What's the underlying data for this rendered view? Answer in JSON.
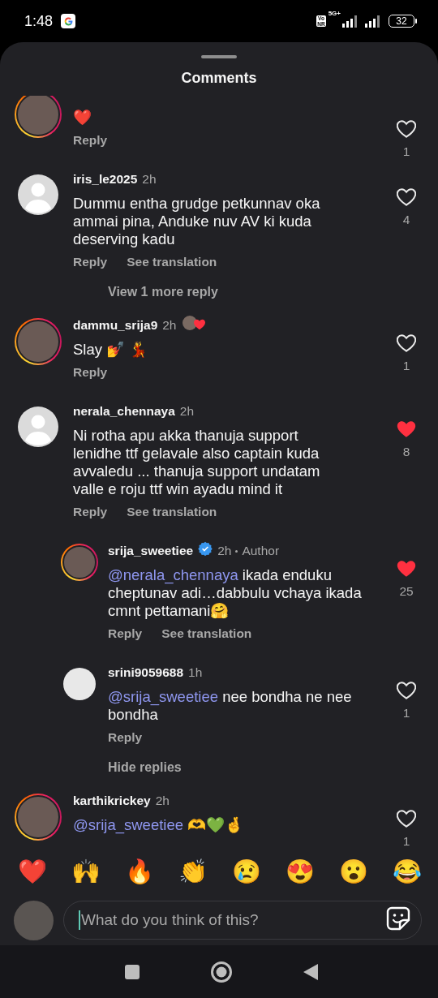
{
  "status_bar": {
    "time": "1:48",
    "network_badge": [
      "Vo",
      "NR"
    ],
    "network_type": "5G+",
    "battery": "32"
  },
  "sheet": {
    "title": "Comments"
  },
  "comments": [
    {
      "kind": "story",
      "text": "❤️",
      "likes": "1",
      "liked": false,
      "actions": [
        "Reply"
      ]
    },
    {
      "kind": "default",
      "username": "iris_le2025",
      "time": "2h",
      "text": "Dummu entha grudge petkunnav oka ammai pina, Anduke nuv AV ki kuda deserving kadu",
      "likes": "4",
      "liked": false,
      "actions": [
        "Reply",
        "See translation"
      ],
      "replies_toggle": "View 1 more reply"
    },
    {
      "kind": "story",
      "username": "dammu_srija9",
      "time": "2h",
      "author_liked": true,
      "text": "Slay 💅 💃",
      "likes": "1",
      "liked": false,
      "actions": [
        "Reply"
      ]
    },
    {
      "kind": "default",
      "username": "nerala_chennaya",
      "time": "2h",
      "text": "Ni rotha apu akka thanuja support lenidhe ttf gelavale also captain kuda avvaledu ... thanuja support undatam valle e roju ttf win ayadu mind it",
      "likes": "8",
      "liked": true,
      "actions": [
        "Reply",
        "See translation"
      ],
      "replies": [
        {
          "kind": "story",
          "username": "srija_sweetiee",
          "verified": true,
          "time": "2h",
          "tag": "Author",
          "mention": "@nerala_chennaya",
          "text": " ikada enduku cheptunav adi…dabbulu vchaya ikada cmnt pettamani🤗",
          "likes": "25",
          "liked": true,
          "actions": [
            "Reply",
            "See translation"
          ]
        },
        {
          "kind": "plain",
          "username": "srini9059688",
          "time": "1h",
          "mention": "@srija_sweetiee",
          "text": " nee bondha ne nee bondha",
          "likes": "1",
          "liked": false,
          "actions": [
            "Reply"
          ]
        }
      ],
      "replies_toggle": "Hide replies"
    },
    {
      "kind": "story",
      "username": "karthikrickey",
      "time": "2h",
      "mention": "@srija_sweetiee",
      "text": " 🫶💚🤞",
      "likes": "1",
      "liked": false
    }
  ],
  "reactions": [
    "❤️",
    "🙌",
    "🔥",
    "👏",
    "😢",
    "😍",
    "😮",
    "😂"
  ],
  "composer": {
    "placeholder": "What do you think of this?"
  }
}
